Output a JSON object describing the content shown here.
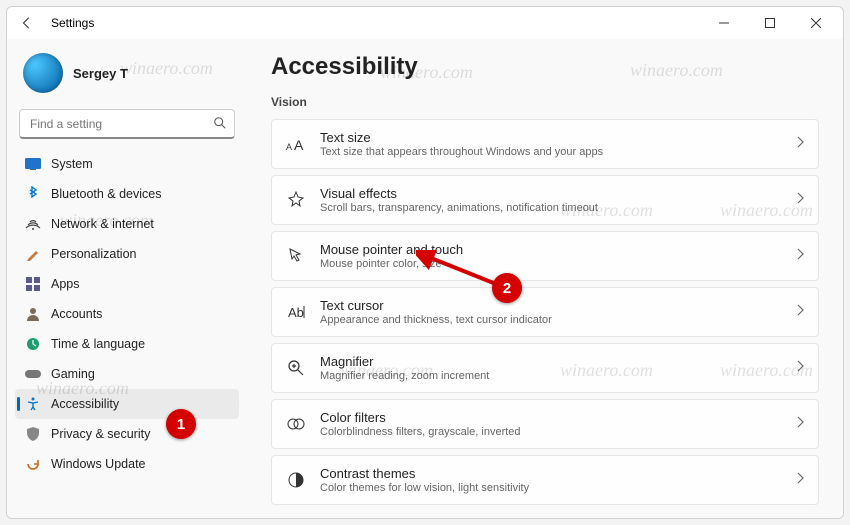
{
  "window": {
    "title": "Settings"
  },
  "profile": {
    "name": "Sergey T"
  },
  "search": {
    "placeholder": "Find a setting"
  },
  "sidebar": {
    "items": [
      {
        "label": "System"
      },
      {
        "label": "Bluetooth & devices"
      },
      {
        "label": "Network & internet"
      },
      {
        "label": "Personalization"
      },
      {
        "label": "Apps"
      },
      {
        "label": "Accounts"
      },
      {
        "label": "Time & language"
      },
      {
        "label": "Gaming"
      },
      {
        "label": "Accessibility"
      },
      {
        "label": "Privacy & security"
      },
      {
        "label": "Windows Update"
      }
    ]
  },
  "page": {
    "title": "Accessibility",
    "section": "Vision",
    "cards": [
      {
        "title": "Text size",
        "sub": "Text size that appears throughout Windows and your apps"
      },
      {
        "title": "Visual effects",
        "sub": "Scroll bars, transparency, animations, notification timeout"
      },
      {
        "title": "Mouse pointer and touch",
        "sub": "Mouse pointer color, size"
      },
      {
        "title": "Text cursor",
        "sub": "Appearance and thickness, text cursor indicator"
      },
      {
        "title": "Magnifier",
        "sub": "Magnifier reading, zoom increment"
      },
      {
        "title": "Color filters",
        "sub": "Colorblindness filters, grayscale, inverted"
      },
      {
        "title": "Contrast themes",
        "sub": "Color themes for low vision, light sensitivity"
      }
    ]
  },
  "annotations": {
    "b1": "1",
    "b2": "2"
  },
  "watermark": "winaero.com"
}
